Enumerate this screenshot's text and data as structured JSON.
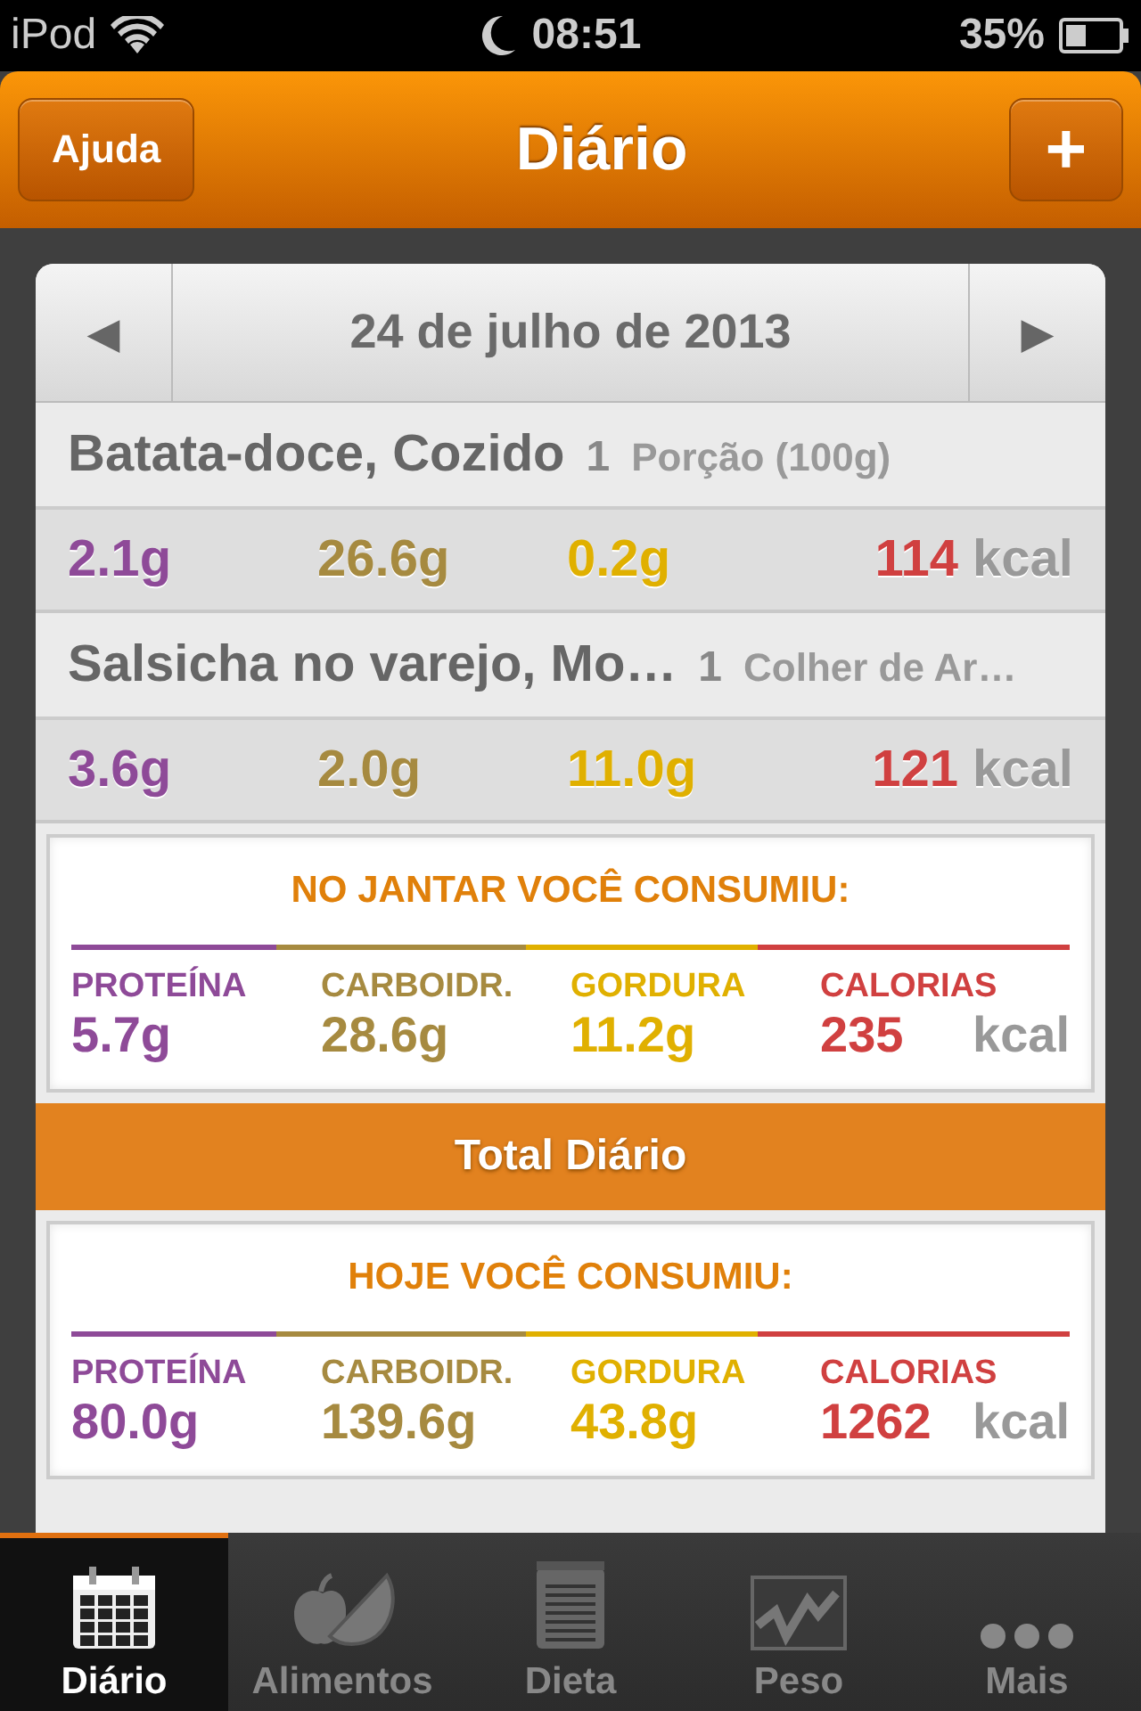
{
  "status_bar": {
    "carrier": "iPod",
    "time": "08:51",
    "battery": "35%"
  },
  "nav_bar": {
    "left_button": "Ajuda",
    "title": "Diário",
    "right_button": "+"
  },
  "date_bar": {
    "prev": "◀",
    "date": "24 de julho de 2013",
    "next": "▶"
  },
  "entries": [
    {
      "name": "Batata-doce, Cozido",
      "quantity": "1",
      "portion": "Porção (100g)",
      "protein": "2.1g",
      "carbs": "26.6g",
      "fat": "0.2g",
      "calories": "114",
      "unit": "kcal"
    },
    {
      "name": "Salsicha no varejo, Mo…",
      "quantity": "1",
      "portion": "Colher de Ar…",
      "protein": "3.6g",
      "carbs": "2.0g",
      "fat": "11.0g",
      "calories": "121",
      "unit": "kcal"
    }
  ],
  "meal_summary": {
    "title": "NO JANTAR VOCÊ CONSUMIU:",
    "nutrients": [
      {
        "label": "PROTEÍNA",
        "value": "5.7g",
        "color": "#8e4a98"
      },
      {
        "label": "CARBOIDR.",
        "value": "28.6g",
        "color": "#a68a40"
      },
      {
        "label": "GORDURA",
        "value": "11.2g",
        "color": "#e0b000"
      },
      {
        "label": "CALORIAS",
        "value": "235",
        "color": "#d04040"
      }
    ],
    "unit": "kcal"
  },
  "total_header": "Total Diário",
  "day_summary": {
    "title": "HOJE VOCÊ CONSUMIU:",
    "nutrients": [
      {
        "label": "PROTEÍNA",
        "value": "80.0g",
        "color": "#8e4a98"
      },
      {
        "label": "CARBOIDR.",
        "value": "139.6g",
        "color": "#a68a40"
      },
      {
        "label": "GORDURA",
        "value": "43.8g",
        "color": "#e0b000"
      },
      {
        "label": "CALORIAS",
        "value": "1262",
        "color": "#d04040"
      }
    ],
    "unit": "kcal"
  },
  "tabs": [
    {
      "label": "Diário",
      "selected": true
    },
    {
      "label": "Alimentos",
      "selected": false
    },
    {
      "label": "Dieta",
      "selected": false
    },
    {
      "label": "Peso",
      "selected": false
    },
    {
      "label": "Mais",
      "selected": false
    }
  ]
}
